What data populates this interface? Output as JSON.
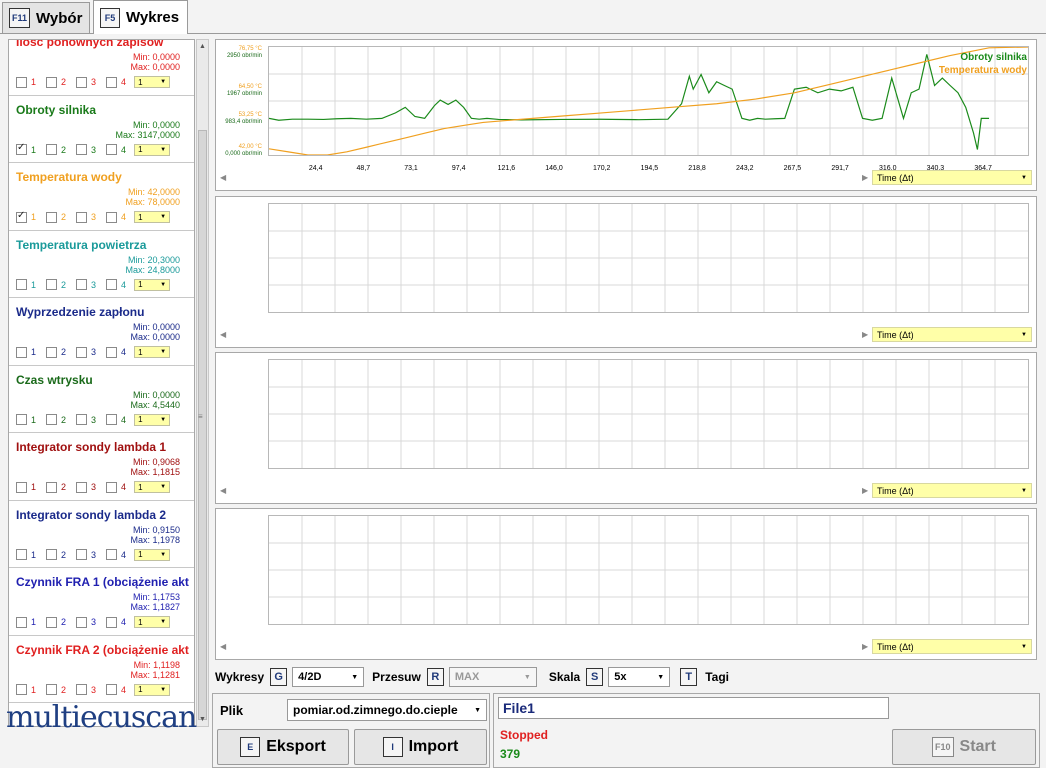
{
  "tabs": [
    {
      "key": "F11",
      "label": "Wybór",
      "active": false
    },
    {
      "key": "F5",
      "label": "Wykres",
      "active": true
    }
  ],
  "channels": [
    {
      "name": "Ilość ponownych zapisów",
      "min": "Min: 0,0000",
      "max": "Max: 0,0000",
      "color": "#e02020",
      "checks": [
        false,
        false,
        false,
        false
      ],
      "sel": "1"
    },
    {
      "name": "Obroty silnika",
      "min": "Min: 0,0000",
      "max": "Max: 3147,0000",
      "color": "#1a7a1a",
      "checks": [
        true,
        false,
        false,
        false
      ],
      "sel": "1"
    },
    {
      "name": "Temperatura wody",
      "min": "Min: 42,0000",
      "max": "Max: 78,0000",
      "color": "#f0a020",
      "checks": [
        true,
        false,
        false,
        false
      ],
      "sel": "1"
    },
    {
      "name": "Temperatura powietrza",
      "min": "Min: 20,3000",
      "max": "Max: 24,8000",
      "color": "#1a9a9a",
      "checks": [
        false,
        false,
        false,
        false
      ],
      "sel": "1"
    },
    {
      "name": "Wyprzedzenie zapłonu",
      "min": "Min: 0,0000",
      "max": "Max: 0,0000",
      "color": "#1a2a8a",
      "checks": [
        false,
        false,
        false,
        false
      ],
      "sel": "1"
    },
    {
      "name": "Czas wtrysku",
      "min": "Min: 0,0000",
      "max": "Max: 4,5440",
      "color": "#1a6a1a",
      "checks": [
        false,
        false,
        false,
        false
      ],
      "sel": "1"
    },
    {
      "name": "Integrator sondy lambda 1",
      "min": "Min: 0,9068",
      "max": "Max: 1,1815",
      "color": "#a01010",
      "checks": [
        false,
        false,
        false,
        false
      ],
      "sel": "1"
    },
    {
      "name": "Integrator sondy lambda 2",
      "min": "Min: 0,9150",
      "max": "Max: 1,1978",
      "color": "#1a2a8a",
      "checks": [
        false,
        false,
        false,
        false
      ],
      "sel": "1"
    },
    {
      "name": "Czynnik FRA 1 (obciążenie akt",
      "min": "Min: 1,1753",
      "max": "Max: 1,1827",
      "color": "#2020b0",
      "checks": [
        false,
        false,
        false,
        false
      ],
      "sel": "1"
    },
    {
      "name": "Czynnik FRA 2 (obciążenie akt",
      "min": "Min: 1,1198",
      "max": "Max: 1,1281",
      "color": "#e02020",
      "checks": [
        false,
        false,
        false,
        false
      ],
      "sel": "1"
    }
  ],
  "checkLabels": [
    "1",
    "2",
    "3",
    "4"
  ],
  "timeSelect": "Time (Δt)",
  "chart_data": {
    "type": "line",
    "x_ticks": [
      "24,4",
      "48,7",
      "73,1",
      "97,4",
      "121,6",
      "146,0",
      "170,2",
      "194,5",
      "218,8",
      "243,2",
      "267,5",
      "291,7",
      "316,0",
      "340,3",
      "364,7"
    ],
    "y_labels_rpm": [
      "2950 obr/min",
      "1967 obr/min",
      "983,4 obr/min",
      "0,000 obr/min"
    ],
    "y_labels_temp": [
      "76,75 °C",
      "64,50 °C",
      "53,25 °C",
      "42,00 °C"
    ],
    "xlim": [
      0,
      390
    ],
    "ylim_rpm": [
      0,
      2950
    ],
    "ylim_temp": [
      42,
      76.75
    ],
    "series": [
      {
        "name": "Obroty silnika",
        "axis": "rpm",
        "color": "#1a8a1a",
        "x": [
          0,
          5,
          12,
          20,
          28,
          35,
          42,
          50,
          58,
          65,
          70,
          75,
          80,
          85,
          88,
          92,
          96,
          100,
          104,
          108,
          112,
          118,
          130,
          150,
          170,
          190,
          205,
          212,
          216,
          218,
          222,
          226,
          230,
          234,
          238,
          243,
          247,
          251,
          255,
          260,
          265,
          270,
          276,
          282,
          288,
          294,
          300,
          305,
          310,
          315,
          320,
          326,
          330,
          334,
          338,
          342,
          346,
          350,
          354,
          358,
          362,
          364,
          366,
          370
        ],
        "y": [
          1000,
          950,
          980,
          980,
          970,
          990,
          1000,
          980,
          1000,
          1150,
          1300,
          1050,
          1000,
          1350,
          1500,
          1380,
          1500,
          1300,
          1000,
          980,
          1000,
          970,
          960,
          970,
          975,
          965,
          980,
          1400,
          2150,
          1800,
          2200,
          1700,
          2000,
          1900,
          1800,
          1000,
          950,
          1000,
          980,
          990,
          1000,
          1800,
          1850,
          1700,
          1800,
          1750,
          1850,
          1000,
          950,
          1000,
          2100,
          1000,
          1700,
          1800,
          2750,
          1900,
          2100,
          1900,
          1700,
          1300,
          600,
          150,
          1000,
          1000
        ]
      },
      {
        "name": "Temperatura wody",
        "axis": "temp",
        "color": "#f0a020",
        "x": [
          0,
          10,
          20,
          30,
          40,
          50,
          60,
          70,
          80,
          90,
          100,
          110,
          120,
          130,
          150,
          170,
          190,
          210,
          230,
          250,
          270,
          290,
          310,
          330,
          350,
          370,
          390
        ],
        "y": [
          44,
          43,
          42,
          42,
          43,
          44.5,
          46,
          47.5,
          49,
          50.5,
          51.5,
          52.5,
          53,
          53.5,
          54.5,
          55.5,
          56.5,
          57.5,
          58.5,
          60,
          62,
          65,
          68,
          71,
          74,
          76.5,
          76.75
        ]
      }
    ]
  },
  "controls": {
    "wykresy_label": "Wykresy",
    "wykresy_key": "G",
    "wykresy_value": "4/2D",
    "przesuw_label": "Przesuw",
    "przesuw_key": "R",
    "przesuw_value": "MAX",
    "skala_label": "Skala",
    "skala_key": "S",
    "skala_value": "5x",
    "tagi_key": "T",
    "tagi_label": "Tagi"
  },
  "file": {
    "label": "Plik",
    "value": "pomiar.od.zimnego.do.cieplе",
    "export_key": "E",
    "export_label": "Eksport",
    "import_key": "I",
    "import_label": "Import"
  },
  "status": {
    "name": "File1",
    "state": "Stopped",
    "count": "379",
    "start_key": "F10",
    "start_label": "Start"
  },
  "logo": "multiecuscan"
}
